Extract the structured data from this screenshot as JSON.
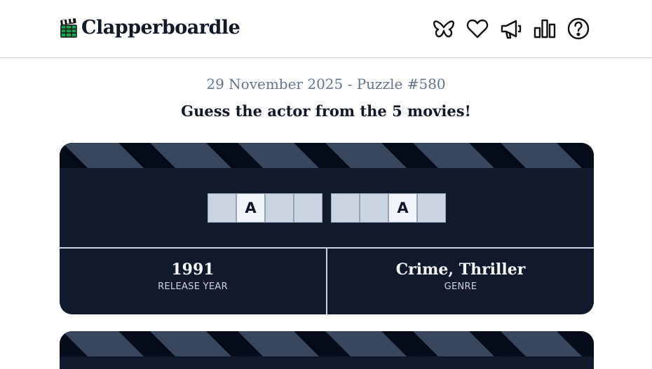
{
  "header": {
    "title": "Clapperboardle",
    "logo_icon": "clapperboard-icon",
    "nav_icons": [
      "butterfly-icon",
      "heart-icon",
      "megaphone-icon",
      "bar-chart-icon",
      "help-icon"
    ]
  },
  "puzzle": {
    "date_label": "29 November 2025 - Puzzle #580",
    "instruction": "Guess the actor from the 5 movies!"
  },
  "movie_card": {
    "words": [
      [
        "",
        "A",
        "",
        ""
      ],
      [
        "",
        "",
        "A",
        ""
      ]
    ],
    "release_year": "1991",
    "release_year_label": "RELEASE YEAR",
    "genre": "Crime, Thriller",
    "genre_label": "GENRE"
  },
  "colors": {
    "card_background": "#111a2c",
    "stripe_dark": "#050b18",
    "stripe_light": "#38465e",
    "tile_hidden": "#cbd5e1",
    "tile_revealed": "#f1f5f9",
    "date_text": "#64748b"
  }
}
